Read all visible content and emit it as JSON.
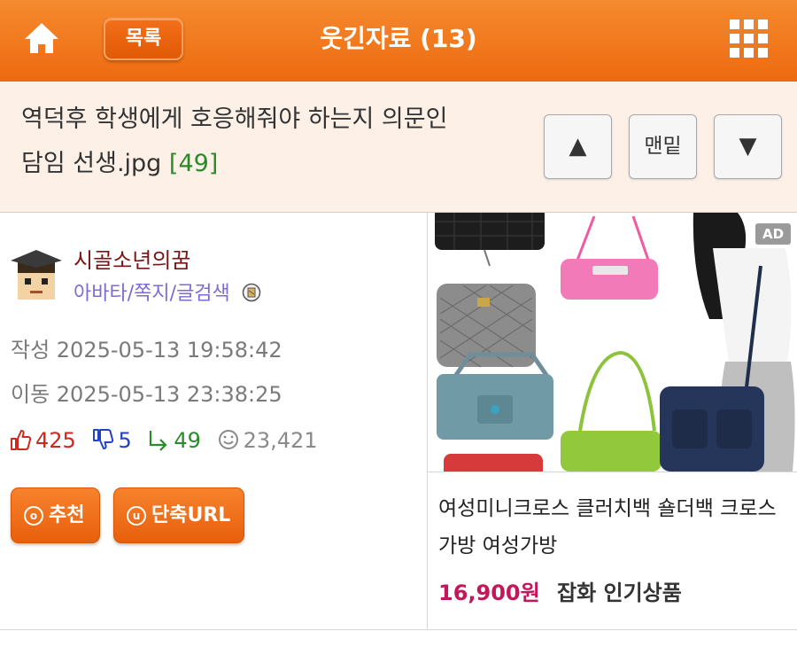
{
  "header": {
    "home_icon": "home-icon",
    "list_label": "목록",
    "board_title": "웃긴자료 (13)",
    "grid_menu_icon": "grid-menu-icon"
  },
  "post": {
    "title_line1": "역덕후 학생에게 호응해줘야 하는지 의문인",
    "title_line2": "담임 선생.jpg",
    "comment_count": "[49]"
  },
  "nav": {
    "up_symbol": "▲",
    "bottom_label": "맨밑",
    "down_symbol": "▼"
  },
  "author": {
    "name": "시골소년의꿈",
    "link_avatar": "아바타",
    "link_message": "쪽지",
    "link_search": "글검색",
    "separator": "/"
  },
  "meta": {
    "written": "작성 2025-05-13 19:58:42",
    "moved": "이동 2025-05-13 23:38:25"
  },
  "stats": {
    "upvotes": "425",
    "downvotes": "5",
    "replies": "49",
    "views": "23,421"
  },
  "actions": {
    "recommend_label": "추천",
    "recommend_icon_letter": "o",
    "shorturl_label": "단축URL",
    "shorturl_icon_letter": "u"
  },
  "ad": {
    "tag": "AD",
    "title": "여성미니크로스 클러치백 숄더백 크로스가방 여성가방",
    "price": "16,900원",
    "shop": "잡화 인기상품"
  },
  "colors": {
    "header_orange": "#ee6a10",
    "title_bg": "#fdf1e7",
    "comment_green": "#2a8a2a",
    "author_red": "#7a1515",
    "link_purple": "#7c6cd4",
    "price_pink": "#c2185b"
  }
}
